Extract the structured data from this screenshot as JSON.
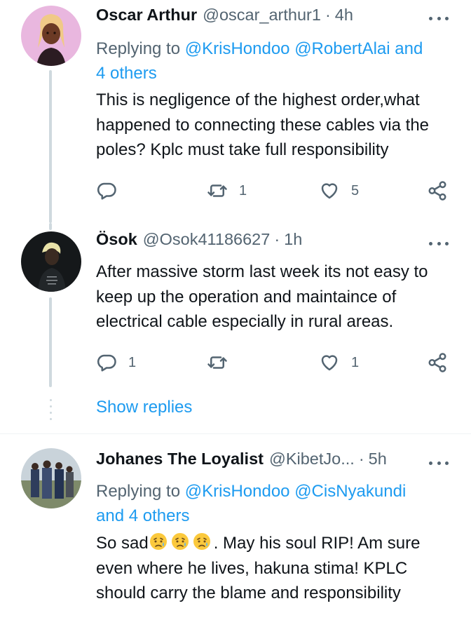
{
  "tweets": [
    {
      "name": "Oscar Arthur",
      "handle": "@oscar_arthur1",
      "sep": "·",
      "time": "4h",
      "replying_prefix": "Replying to ",
      "replying_to_1": "@KrisHondoo",
      "replying_to_2": "@RobertAlai",
      "replying_and": " and",
      "replying_others": "4 others",
      "text": "This is negligence of the highest order,what happened to connecting these cables via the poles? Kplc must take full responsibility",
      "reply_count": "",
      "retweet_count": "1",
      "like_count": "5"
    },
    {
      "name": "Ösok",
      "handle": "@Osok41186627",
      "sep": "·",
      "time": "1h",
      "text": "After massive storm  last week its not easy to keep up the operation and maintaince  of electrical cable especially in rural areas.",
      "reply_count": "1",
      "retweet_count": "",
      "like_count": "1"
    },
    {
      "name": "Johanes The Loyalist",
      "handle": "@KibetJo...",
      "sep": "·",
      "time": "5h",
      "replying_prefix": "Replying to ",
      "replying_to_1": "@KrisHondoo",
      "replying_to_2": "@CisNyakundi",
      "replying_and": "and ",
      "replying_others": "4 others",
      "text_prefix": "So sad",
      "text_suffix": ". May his soul RIP! Am sure even where he lives, hakuna stima! KPLC should carry the blame and responsibility"
    }
  ],
  "show_replies": "Show replies",
  "icons": {
    "reply": "reply-icon",
    "retweet": "retweet-icon",
    "like": "heart-icon",
    "share": "share-icon",
    "more": "more-icon",
    "emoji": "sad-tear-emoji"
  },
  "colors": {
    "link": "#1d9bf0",
    "muted": "#536471",
    "text": "#0f1419",
    "thread_line": "#cfd9de"
  }
}
